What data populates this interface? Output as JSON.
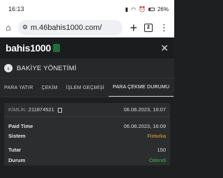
{
  "statusbar": {
    "time": "16:13",
    "battery": "26%"
  },
  "browser": {
    "url": "m.46bahis1000.com/",
    "tabs_count": "2"
  },
  "brand": {
    "logo": "bahis1000"
  },
  "page": {
    "title": "BAKİYE YÖNETİMİ"
  },
  "tabs": [
    {
      "label": "PARA YATIR"
    },
    {
      "label": "ÇEKİM"
    },
    {
      "label": "İŞLEM GEÇMİŞİ"
    },
    {
      "label": "PARA ÇEKME DURUMU"
    }
  ],
  "record": {
    "id_label": "KİMLİK:",
    "id_value": "211874521",
    "id_date": "06.08.2023, 16:07",
    "paid_time_label": "Paid Time",
    "paid_time_value": "06.08.2023, 16:09",
    "system_label": "Sistem",
    "system_value": "Fixturka",
    "amount_label": "Tutar",
    "amount_value": "150",
    "status_label": "Durum",
    "status_value": "Ödendi"
  },
  "colors": {
    "system": "#f3a43a",
    "status": "#39b54a"
  }
}
